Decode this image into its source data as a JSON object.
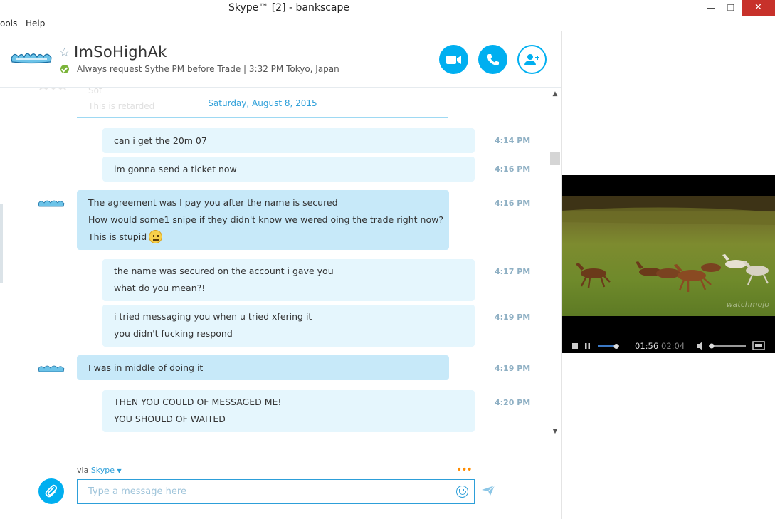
{
  "window": {
    "title": "Skype™ [2] - bankscape",
    "min_glyph": "—",
    "max_glyph": "❐",
    "close_glyph": "✕"
  },
  "menu": [
    "ools",
    "Help"
  ],
  "header": {
    "contact_name": "ImSoHighAk",
    "mood": "Always request Sythe PM before Trade  |  3:32 PM Tokyo, Japan",
    "status": "online",
    "icons": [
      "star-icon",
      "video-call-icon",
      "call-icon",
      "add-contact-icon"
    ]
  },
  "chat": {
    "ghost_lines": [
      "Sot",
      "This is retarded"
    ],
    "date": "Saturday, August 8, 2015",
    "messages": [
      {
        "dir": "out",
        "lines": [
          "can i get the 20m 07"
        ],
        "time": "4:14 PM"
      },
      {
        "dir": "out",
        "lines": [
          "im gonna send a ticket now"
        ],
        "time": "4:16 PM"
      },
      {
        "dir": "in",
        "lines": [
          "The agreement was I pay you after the name is secured",
          "How would some1 snipe if they didn't know we wered oing the trade right now?",
          "This is stupid"
        ],
        "time": "4:16 PM",
        "emoji": "confused-face"
      },
      {
        "dir": "out",
        "lines": [
          "the name was secured on the account i gave you",
          "what do you mean?!"
        ],
        "time": "4:17 PM"
      },
      {
        "dir": "out",
        "lines": [
          "i tried messaging you when u tried xfering it",
          "you didn't fucking respond"
        ],
        "time": "4:19 PM"
      },
      {
        "dir": "in",
        "lines": [
          "I was in middle of doing it"
        ],
        "time": "4:19 PM"
      },
      {
        "dir": "out",
        "lines": [
          "THEN YOU COULD OF MESSAGED ME!",
          "YOU SHOULD OF WAITED"
        ],
        "time": "4:20 PM"
      }
    ]
  },
  "composer": {
    "via_prefix": "via",
    "via_service": "Skype",
    "placeholder": "Type a message here",
    "typing_indicator": "•••"
  },
  "video": {
    "current_time": "01:56",
    "total_time": "02:04",
    "watermark": "watchmojo"
  },
  "colors": {
    "accent": "#00aff0",
    "bubble_out": "#e5f6fd",
    "bubble_in": "#c7e9f9",
    "close": "#c7312a"
  }
}
